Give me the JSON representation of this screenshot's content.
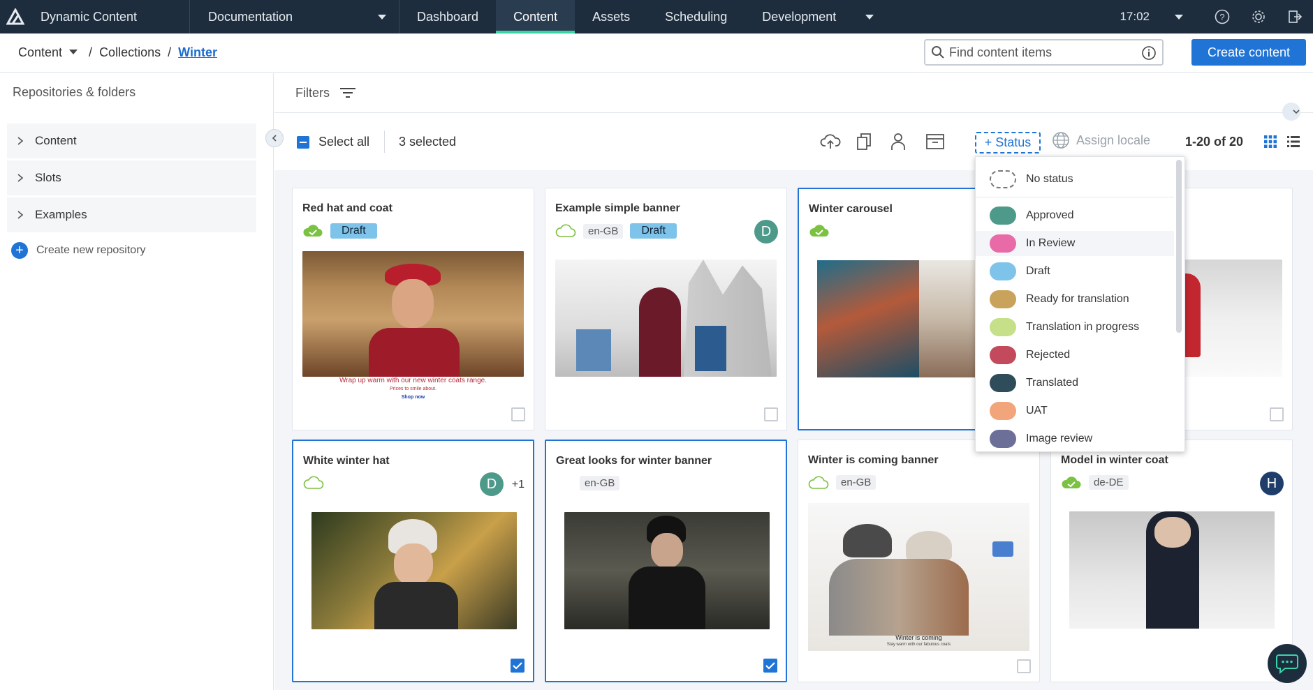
{
  "nav": {
    "app_name": "Dynamic Content",
    "hub": "Documentation",
    "tabs": [
      {
        "label": "Dashboard",
        "active": false
      },
      {
        "label": "Content",
        "active": true
      },
      {
        "label": "Assets",
        "active": false
      },
      {
        "label": "Scheduling",
        "active": false
      },
      {
        "label": "Development",
        "active": false
      }
    ],
    "clock": "17:02",
    "icons": [
      "help-icon",
      "settings-icon",
      "sign-out-icon"
    ]
  },
  "breadcrumb": {
    "root": "Content",
    "sep": "/",
    "collections": "Collections",
    "current": "Winter"
  },
  "search": {
    "placeholder": "Find content items"
  },
  "create_button": "Create content",
  "sidebar": {
    "title": "Repositories & folders",
    "items": [
      "Content",
      "Slots",
      "Examples"
    ],
    "create_repo": "Create new repository"
  },
  "filters": {
    "label": "Filters"
  },
  "toolbar": {
    "select_all": "Select all",
    "selected": "3 selected",
    "status_button": "+ Status",
    "assign_locale": "Assign locale",
    "pager": "1-20 of 20",
    "action_icons": [
      "publish-icon",
      "copy-icon",
      "assign-user-icon",
      "archive-icon"
    ]
  },
  "cards": [
    {
      "title": "Red hat and coat",
      "status": "Draft",
      "locale": "",
      "avatar": "",
      "selected": false,
      "caption": [
        "Wrap up warm with our new winter coats range.",
        "Prices to smile about.",
        "Shop now"
      ]
    },
    {
      "title": "Example simple banner",
      "status": "Draft",
      "locale": "en-GB",
      "avatar": "D",
      "selected": false
    },
    {
      "title": "Winter carousel",
      "status": "",
      "locale": "",
      "avatar": "",
      "selected": true
    },
    {
      "title": "",
      "status": "",
      "locale": "",
      "avatar": "",
      "selected": false
    },
    {
      "title": "White winter hat",
      "status": "",
      "locale": "",
      "avatar": "D",
      "extra_users": "+1",
      "selected": true
    },
    {
      "title": "Great looks for winter banner",
      "status": "",
      "locale": "en-GB",
      "avatar": "",
      "selected": true
    },
    {
      "title": "Winter is coming banner",
      "status": "",
      "locale": "en-GB",
      "avatar": "",
      "selected": false,
      "caption": [
        "Winter is coming",
        "Stay warm with our fabulous coats"
      ]
    },
    {
      "title": "Model in winter coat",
      "status": "",
      "locale": "de-DE",
      "avatar": "H",
      "selected": false
    }
  ],
  "status_menu": {
    "items": [
      {
        "label": "No status",
        "color": "none"
      },
      {
        "label": "Approved",
        "color": "#4e9a8a"
      },
      {
        "label": "In Review",
        "color": "#e86aa6"
      },
      {
        "label": "Draft",
        "color": "#7ec3ea"
      },
      {
        "label": "Ready for translation",
        "color": "#c9a35b"
      },
      {
        "label": "Translation in progress",
        "color": "#c6e08a"
      },
      {
        "label": "Rejected",
        "color": "#c24a5c"
      },
      {
        "label": "Translated",
        "color": "#2f4c5a"
      },
      {
        "label": "UAT",
        "color": "#f2a57a"
      },
      {
        "label": "Image review",
        "color": "#6c6f98"
      }
    ],
    "hovered": "In Review"
  },
  "colors": {
    "accent": "#1f74d6",
    "nav_bg": "#1e2d3d",
    "active_tab": "#3bd3a8",
    "avatar_green": "#4e9a8a",
    "avatar_navy": "#1e3d6b",
    "cloud_green": "#7bc142"
  }
}
